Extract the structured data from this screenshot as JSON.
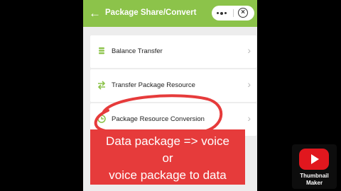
{
  "header": {
    "title": "Package Share/Convert",
    "more_icon": "more-dots-icon",
    "close_icon": "close-circle-icon"
  },
  "menu": {
    "items": [
      {
        "label": "Balance Transfer",
        "icon": "coins-icon"
      },
      {
        "label": "Transfer Package Resource",
        "icon": "swap-arrows-icon"
      },
      {
        "label": "Package Resource Conversion",
        "icon": "convert-icon"
      }
    ]
  },
  "overlay": {
    "line1": "Data package => voice",
    "line2": "or",
    "line3": "voice package to data"
  },
  "badge": {
    "line1": "Thumbnail",
    "line2": "Maker"
  },
  "colors": {
    "header": "#8cc34a",
    "annotation_red": "#e63b3b",
    "background": "#000000"
  }
}
